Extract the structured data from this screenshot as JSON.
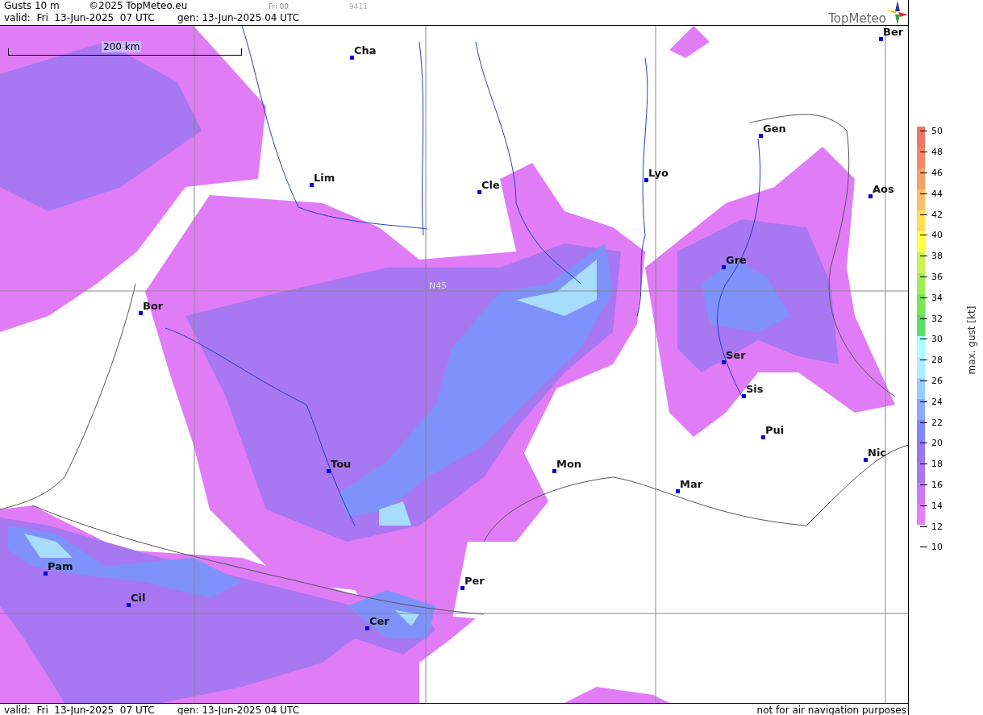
{
  "header": {
    "title": "Gusts 10 m",
    "copyright": "©2025 TopMeteo.eu",
    "run": "Fri 00",
    "code": "9411",
    "valid": "valid:  Fri  13-Jun-2025  07 UTC",
    "gen": "gen: 13-Jun-2025 04 UTC",
    "logo": "TopMeteo"
  },
  "map": {
    "scale": "200 km",
    "gridlabel": "N45",
    "cities": [
      {
        "name": "Cha"
      },
      {
        "name": "Ber"
      },
      {
        "name": "Gen"
      },
      {
        "name": "Lim"
      },
      {
        "name": "Cle"
      },
      {
        "name": "Lyo"
      },
      {
        "name": "Aos"
      },
      {
        "name": "Gre"
      },
      {
        "name": "Bor"
      },
      {
        "name": "Ser"
      },
      {
        "name": "Sis"
      },
      {
        "name": "Pui"
      },
      {
        "name": "Nic"
      },
      {
        "name": "Tou"
      },
      {
        "name": "Mon"
      },
      {
        "name": "Mar"
      },
      {
        "name": "Pam"
      },
      {
        "name": "Cil"
      },
      {
        "name": "Per"
      },
      {
        "name": "Cer"
      }
    ]
  },
  "legend": {
    "title": "max. gust [kt]",
    "ticks": [
      "50",
      "48",
      "46",
      "44",
      "42",
      "40",
      "38",
      "36",
      "34",
      "32",
      "30",
      "28",
      "26",
      "24",
      "22",
      "20",
      "18",
      "16",
      "14",
      "12",
      "10"
    ],
    "bands": [
      {
        "color": "#ee7766"
      },
      {
        "color": "#f48866"
      },
      {
        "color": "#f7a066"
      },
      {
        "color": "#fbbf66"
      },
      {
        "color": "#ffdd55"
      },
      {
        "color": "#ffff44"
      },
      {
        "color": "#ccf055"
      },
      {
        "color": "#a0ee55"
      },
      {
        "color": "#77e855"
      },
      {
        "color": "#55e066"
      },
      {
        "color": "#aaffff"
      },
      {
        "color": "#aaeeff"
      },
      {
        "color": "#99ccff"
      },
      {
        "color": "#88aaff"
      },
      {
        "color": "#7f88ff"
      },
      {
        "color": "#9977ee"
      },
      {
        "color": "#aa77f0"
      },
      {
        "color": "#cc77f5"
      },
      {
        "color": "#e680f7"
      }
    ]
  },
  "footer": {
    "valid": "valid:  Fri  13-Jun-2025  07 UTC",
    "gen": "gen: 13-Jun-2025 04 UTC",
    "note": "not for air navigation purposes"
  }
}
